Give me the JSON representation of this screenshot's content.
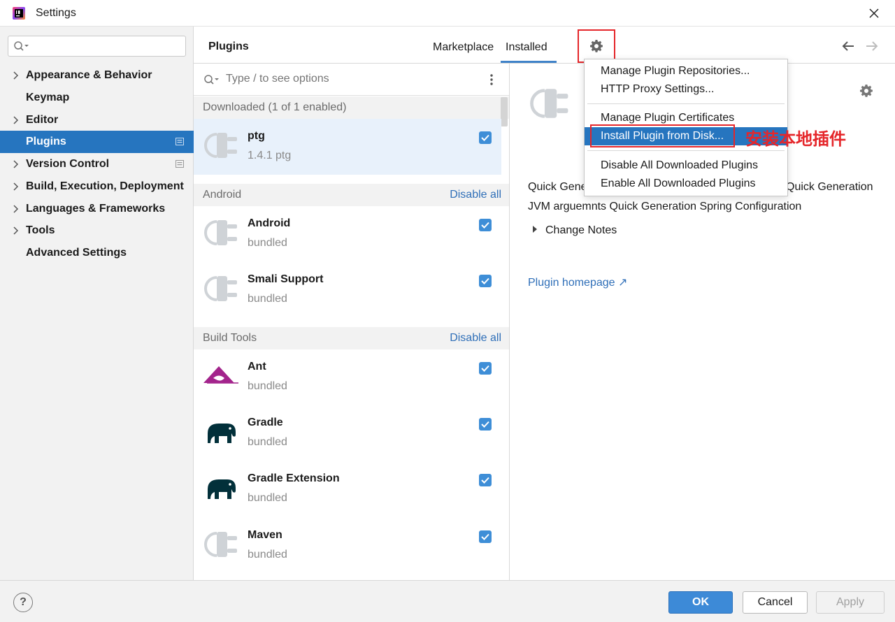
{
  "window": {
    "title": "Settings",
    "app_icon": "intellij-idea-logo",
    "close_icon": "close-x"
  },
  "sidebar": {
    "search": {
      "value": "",
      "placeholder": ""
    },
    "items": [
      {
        "label": "Appearance & Behavior",
        "expandable": true,
        "selected": false
      },
      {
        "label": "Keymap",
        "expandable": false,
        "selected": false
      },
      {
        "label": "Editor",
        "expandable": true,
        "selected": false
      },
      {
        "label": "Plugins",
        "expandable": false,
        "selected": true,
        "project_mark": true
      },
      {
        "label": "Version Control",
        "expandable": true,
        "selected": false,
        "project_mark": true
      },
      {
        "label": "Build, Execution, Deployment",
        "expandable": true,
        "selected": false
      },
      {
        "label": "Languages & Frameworks",
        "expandable": true,
        "selected": false
      },
      {
        "label": "Tools",
        "expandable": true,
        "selected": false
      },
      {
        "label": "Advanced Settings",
        "expandable": false,
        "selected": false
      }
    ]
  },
  "header": {
    "title": "Plugins",
    "tabs": [
      {
        "label": "Marketplace",
        "active": false
      },
      {
        "label": "Installed",
        "active": true
      }
    ]
  },
  "plugin_list": {
    "search_placeholder": "Type / to see options",
    "groups": [
      {
        "label": "Downloaded (1 of 1 enabled)",
        "action": ""
      },
      {
        "label": "Android",
        "action": "Disable all"
      },
      {
        "label": "Build Tools",
        "action": "Disable all"
      }
    ],
    "plugins": [
      {
        "name": "ptg",
        "sub": "1.4.1  ptg",
        "enabled": true,
        "icon": "plug-icon",
        "selected": true
      },
      {
        "name": "Android",
        "sub": "bundled",
        "enabled": true,
        "icon": "plug-icon"
      },
      {
        "name": "Smali Support",
        "sub": "bundled",
        "enabled": true,
        "icon": "plug-icon"
      },
      {
        "name": "Ant",
        "sub": "bundled",
        "enabled": true,
        "icon": "ant-logo"
      },
      {
        "name": "Gradle",
        "sub": "bundled",
        "enabled": true,
        "icon": "gradle-elephant-icon"
      },
      {
        "name": "Gradle Extension",
        "sub": "bundled",
        "enabled": true,
        "icon": "gradle-elephant-icon"
      },
      {
        "name": "Maven",
        "sub": "bundled",
        "enabled": true,
        "icon": "plug-icon"
      }
    ]
  },
  "detail": {
    "description_part1": "Quick Gene",
    "description_part2": "Quick Generation",
    "description_line2": "JVM arguemnts Quick Generation Spring Configuration",
    "change_notes": "Change Notes",
    "homepage": "Plugin homepage ↗"
  },
  "gear_menu": {
    "items": [
      {
        "label": "Manage Plugin Repositories..."
      },
      {
        "label": "HTTP Proxy Settings..."
      },
      {
        "label": "Manage Plugin Certificates"
      },
      {
        "label": "Install Plugin from Disk...",
        "highlighted": true
      },
      {
        "label": "Disable All Downloaded Plugins"
      },
      {
        "label": "Enable All Downloaded Plugins"
      }
    ]
  },
  "annotation": {
    "text": "安装本地插件",
    "color": "#e5262a"
  },
  "footer": {
    "help": "?",
    "ok": "OK",
    "cancel": "Cancel",
    "apply": "Apply"
  },
  "colors": {
    "accent": "#2675bf",
    "link": "#2f6fb8",
    "checkbox": "#3e8ed7",
    "annotation": "#e5262a"
  }
}
